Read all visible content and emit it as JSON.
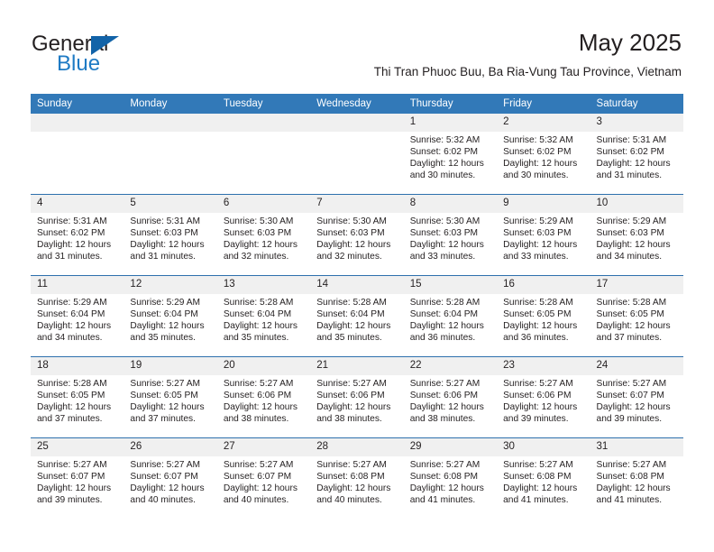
{
  "brand": {
    "name_top": "General",
    "name_bottom": "Blue",
    "accent_color": "#1263a8",
    "text_color": "#1e7ac4"
  },
  "header": {
    "title": "May 2025",
    "location": "Thi Tran Phuoc Buu, Ba Ria-Vung Tau Province, Vietnam"
  },
  "theme": {
    "header_blue": "#3279b8",
    "rule_blue": "#2e70ad",
    "daynum_band": "#f0f0f0"
  },
  "weekdays": [
    "Sunday",
    "Monday",
    "Tuesday",
    "Wednesday",
    "Thursday",
    "Friday",
    "Saturday"
  ],
  "labels": {
    "sunrise_prefix": "Sunrise: ",
    "sunset_prefix": "Sunset: ",
    "daylight_prefix": "Daylight: "
  },
  "weeks": [
    [
      {
        "day": "",
        "sunrise": "",
        "sunset": "",
        "daylight_l1": "",
        "daylight_l2": ""
      },
      {
        "day": "",
        "sunrise": "",
        "sunset": "",
        "daylight_l1": "",
        "daylight_l2": ""
      },
      {
        "day": "",
        "sunrise": "",
        "sunset": "",
        "daylight_l1": "",
        "daylight_l2": ""
      },
      {
        "day": "",
        "sunrise": "",
        "sunset": "",
        "daylight_l1": "",
        "daylight_l2": ""
      },
      {
        "day": "1",
        "sunrise": "Sunrise: 5:32 AM",
        "sunset": "Sunset: 6:02 PM",
        "daylight_l1": "Daylight: 12 hours",
        "daylight_l2": "and 30 minutes."
      },
      {
        "day": "2",
        "sunrise": "Sunrise: 5:32 AM",
        "sunset": "Sunset: 6:02 PM",
        "daylight_l1": "Daylight: 12 hours",
        "daylight_l2": "and 30 minutes."
      },
      {
        "day": "3",
        "sunrise": "Sunrise: 5:31 AM",
        "sunset": "Sunset: 6:02 PM",
        "daylight_l1": "Daylight: 12 hours",
        "daylight_l2": "and 31 minutes."
      }
    ],
    [
      {
        "day": "4",
        "sunrise": "Sunrise: 5:31 AM",
        "sunset": "Sunset: 6:02 PM",
        "daylight_l1": "Daylight: 12 hours",
        "daylight_l2": "and 31 minutes."
      },
      {
        "day": "5",
        "sunrise": "Sunrise: 5:31 AM",
        "sunset": "Sunset: 6:03 PM",
        "daylight_l1": "Daylight: 12 hours",
        "daylight_l2": "and 31 minutes."
      },
      {
        "day": "6",
        "sunrise": "Sunrise: 5:30 AM",
        "sunset": "Sunset: 6:03 PM",
        "daylight_l1": "Daylight: 12 hours",
        "daylight_l2": "and 32 minutes."
      },
      {
        "day": "7",
        "sunrise": "Sunrise: 5:30 AM",
        "sunset": "Sunset: 6:03 PM",
        "daylight_l1": "Daylight: 12 hours",
        "daylight_l2": "and 32 minutes."
      },
      {
        "day": "8",
        "sunrise": "Sunrise: 5:30 AM",
        "sunset": "Sunset: 6:03 PM",
        "daylight_l1": "Daylight: 12 hours",
        "daylight_l2": "and 33 minutes."
      },
      {
        "day": "9",
        "sunrise": "Sunrise: 5:29 AM",
        "sunset": "Sunset: 6:03 PM",
        "daylight_l1": "Daylight: 12 hours",
        "daylight_l2": "and 33 minutes."
      },
      {
        "day": "10",
        "sunrise": "Sunrise: 5:29 AM",
        "sunset": "Sunset: 6:03 PM",
        "daylight_l1": "Daylight: 12 hours",
        "daylight_l2": "and 34 minutes."
      }
    ],
    [
      {
        "day": "11",
        "sunrise": "Sunrise: 5:29 AM",
        "sunset": "Sunset: 6:04 PM",
        "daylight_l1": "Daylight: 12 hours",
        "daylight_l2": "and 34 minutes."
      },
      {
        "day": "12",
        "sunrise": "Sunrise: 5:29 AM",
        "sunset": "Sunset: 6:04 PM",
        "daylight_l1": "Daylight: 12 hours",
        "daylight_l2": "and 35 minutes."
      },
      {
        "day": "13",
        "sunrise": "Sunrise: 5:28 AM",
        "sunset": "Sunset: 6:04 PM",
        "daylight_l1": "Daylight: 12 hours",
        "daylight_l2": "and 35 minutes."
      },
      {
        "day": "14",
        "sunrise": "Sunrise: 5:28 AM",
        "sunset": "Sunset: 6:04 PM",
        "daylight_l1": "Daylight: 12 hours",
        "daylight_l2": "and 35 minutes."
      },
      {
        "day": "15",
        "sunrise": "Sunrise: 5:28 AM",
        "sunset": "Sunset: 6:04 PM",
        "daylight_l1": "Daylight: 12 hours",
        "daylight_l2": "and 36 minutes."
      },
      {
        "day": "16",
        "sunrise": "Sunrise: 5:28 AM",
        "sunset": "Sunset: 6:05 PM",
        "daylight_l1": "Daylight: 12 hours",
        "daylight_l2": "and 36 minutes."
      },
      {
        "day": "17",
        "sunrise": "Sunrise: 5:28 AM",
        "sunset": "Sunset: 6:05 PM",
        "daylight_l1": "Daylight: 12 hours",
        "daylight_l2": "and 37 minutes."
      }
    ],
    [
      {
        "day": "18",
        "sunrise": "Sunrise: 5:28 AM",
        "sunset": "Sunset: 6:05 PM",
        "daylight_l1": "Daylight: 12 hours",
        "daylight_l2": "and 37 minutes."
      },
      {
        "day": "19",
        "sunrise": "Sunrise: 5:27 AM",
        "sunset": "Sunset: 6:05 PM",
        "daylight_l1": "Daylight: 12 hours",
        "daylight_l2": "and 37 minutes."
      },
      {
        "day": "20",
        "sunrise": "Sunrise: 5:27 AM",
        "sunset": "Sunset: 6:06 PM",
        "daylight_l1": "Daylight: 12 hours",
        "daylight_l2": "and 38 minutes."
      },
      {
        "day": "21",
        "sunrise": "Sunrise: 5:27 AM",
        "sunset": "Sunset: 6:06 PM",
        "daylight_l1": "Daylight: 12 hours",
        "daylight_l2": "and 38 minutes."
      },
      {
        "day": "22",
        "sunrise": "Sunrise: 5:27 AM",
        "sunset": "Sunset: 6:06 PM",
        "daylight_l1": "Daylight: 12 hours",
        "daylight_l2": "and 38 minutes."
      },
      {
        "day": "23",
        "sunrise": "Sunrise: 5:27 AM",
        "sunset": "Sunset: 6:06 PM",
        "daylight_l1": "Daylight: 12 hours",
        "daylight_l2": "and 39 minutes."
      },
      {
        "day": "24",
        "sunrise": "Sunrise: 5:27 AM",
        "sunset": "Sunset: 6:07 PM",
        "daylight_l1": "Daylight: 12 hours",
        "daylight_l2": "and 39 minutes."
      }
    ],
    [
      {
        "day": "25",
        "sunrise": "Sunrise: 5:27 AM",
        "sunset": "Sunset: 6:07 PM",
        "daylight_l1": "Daylight: 12 hours",
        "daylight_l2": "and 39 minutes."
      },
      {
        "day": "26",
        "sunrise": "Sunrise: 5:27 AM",
        "sunset": "Sunset: 6:07 PM",
        "daylight_l1": "Daylight: 12 hours",
        "daylight_l2": "and 40 minutes."
      },
      {
        "day": "27",
        "sunrise": "Sunrise: 5:27 AM",
        "sunset": "Sunset: 6:07 PM",
        "daylight_l1": "Daylight: 12 hours",
        "daylight_l2": "and 40 minutes."
      },
      {
        "day": "28",
        "sunrise": "Sunrise: 5:27 AM",
        "sunset": "Sunset: 6:08 PM",
        "daylight_l1": "Daylight: 12 hours",
        "daylight_l2": "and 40 minutes."
      },
      {
        "day": "29",
        "sunrise": "Sunrise: 5:27 AM",
        "sunset": "Sunset: 6:08 PM",
        "daylight_l1": "Daylight: 12 hours",
        "daylight_l2": "and 41 minutes."
      },
      {
        "day": "30",
        "sunrise": "Sunrise: 5:27 AM",
        "sunset": "Sunset: 6:08 PM",
        "daylight_l1": "Daylight: 12 hours",
        "daylight_l2": "and 41 minutes."
      },
      {
        "day": "31",
        "sunrise": "Sunrise: 5:27 AM",
        "sunset": "Sunset: 6:08 PM",
        "daylight_l1": "Daylight: 12 hours",
        "daylight_l2": "and 41 minutes."
      }
    ]
  ]
}
